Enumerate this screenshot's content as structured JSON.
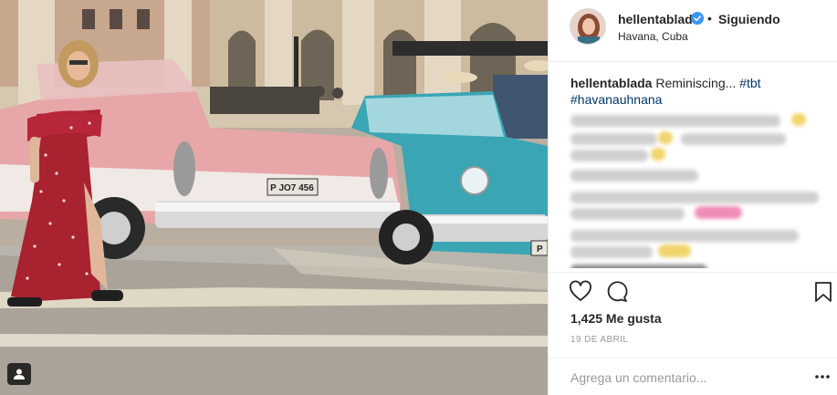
{
  "post": {
    "username": "hellentablada",
    "follow_state": "Siguiendo",
    "separator": "•",
    "location": "Havana, Cuba",
    "caption": {
      "username": "hellentablada",
      "text": "Reminiscing...",
      "hashtags": [
        "#tbt",
        "#havanauhnana"
      ]
    },
    "license_plate": "P JO7 456",
    "right_car_plate": "P",
    "likes": "1,425 Me gusta",
    "date": "19 DE ABRIL",
    "comment_placeholder": "Agrega un comentario..."
  },
  "icons": {
    "verified": "verified-badge-icon",
    "like": "heart-icon",
    "comment": "comment-bubble-icon",
    "save": "bookmark-icon",
    "tagged_people": "person-tag-icon",
    "more": "more-options-icon"
  },
  "colors": {
    "verified": "#3897f0",
    "hashtag": "#003569",
    "text": "#262626",
    "muted": "#999999",
    "divider": "#efefef"
  }
}
